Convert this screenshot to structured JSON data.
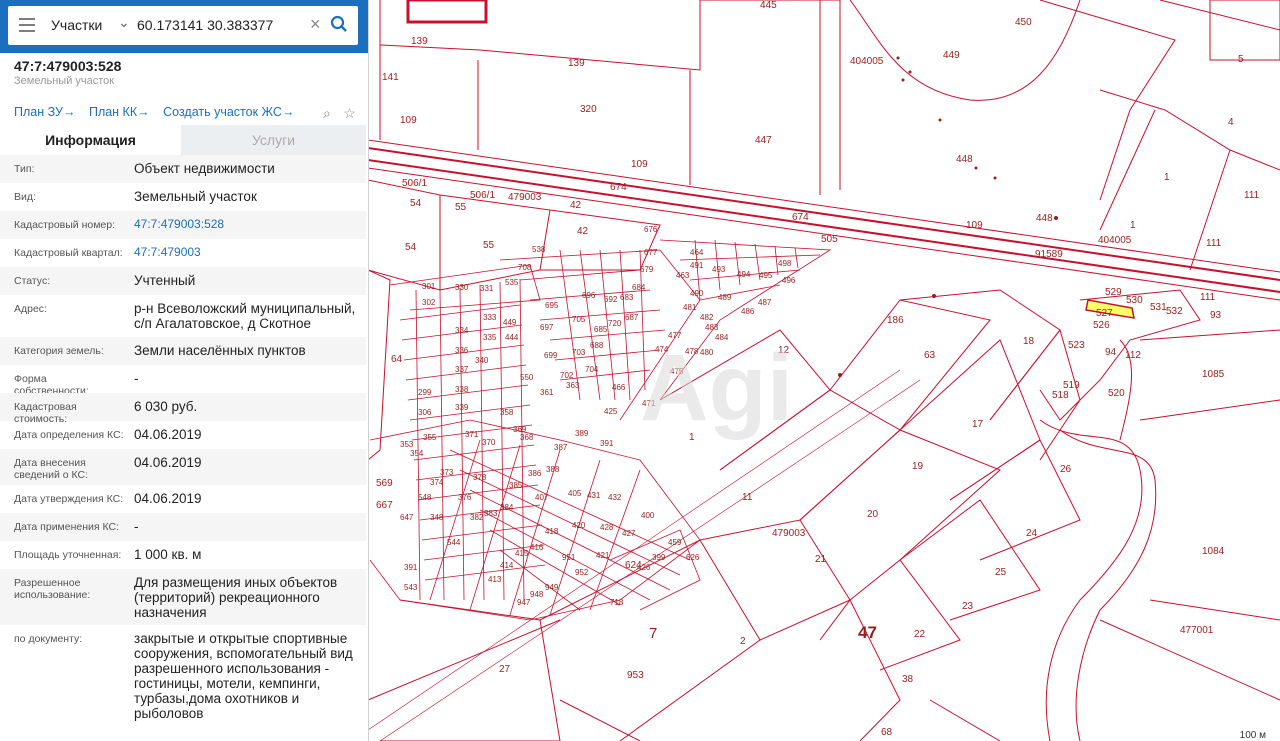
{
  "search": {
    "layer": "Участки",
    "query": "60.173141 30.383377"
  },
  "parcel": {
    "number": "47:7:479003:528",
    "type_label": "Земельный участок"
  },
  "links": [
    "План ЗУ",
    "План КК",
    "Создать участок ЖС"
  ],
  "tabs": {
    "info": "Информация",
    "services": "Услуги"
  },
  "info_rows": [
    {
      "label": "Тип:",
      "value": "Объект недвижимости"
    },
    {
      "label": "Вид:",
      "value": "Земельный участок"
    },
    {
      "label": "Кадастровый номер:",
      "value": "47:7:479003:528",
      "link": true
    },
    {
      "label": "Кадастровый квартал:",
      "value": "47:7:479003",
      "link": true
    },
    {
      "label": "Статус:",
      "value": "Учтенный"
    },
    {
      "label": "Адрес:",
      "value": "р-н Всеволожский муниципальный, с/п Агалатовское, д Скотное"
    },
    {
      "label": "Категория земель:",
      "value": "Земли населённых пунктов"
    },
    {
      "label": "Форма собственности:",
      "value": "-"
    },
    {
      "label": "Кадастровая стоимость:",
      "value": "6 030 руб."
    },
    {
      "label": "Дата определения КС:",
      "value": "04.06.2019"
    },
    {
      "label": "Дата внесения сведений о КС:",
      "value": "04.06.2019"
    },
    {
      "label": "Дата утверждения КС:",
      "value": "04.06.2019"
    },
    {
      "label": "Дата применения КС:",
      "value": "-"
    },
    {
      "label": "Площадь уточненная:",
      "value": "1 000 кв. м"
    },
    {
      "label": "Разрешенное использование:",
      "value": "Для размещения иных объектов (территорий) рекреационного назначения"
    },
    {
      "label": "по документу:",
      "value": "закрытые и открытые спортивные сооружения, вспомогательный вид разрешенного использования - гостиницы, мотели, кемпинги, турбазы,дома охотников и рыболовов"
    }
  ],
  "map_labels": {
    "quarter_main": "479003",
    "quarter_main2": "479003",
    "quarter_east": "404005",
    "quarter_ne": "404005",
    "quarter_se": "477001",
    "region": "47",
    "big_7": "7",
    "scale": "100 м"
  },
  "colors": {
    "accent": "#1b6fbe",
    "parcel_line": "#c8102e",
    "highlight": "#ffff66"
  }
}
